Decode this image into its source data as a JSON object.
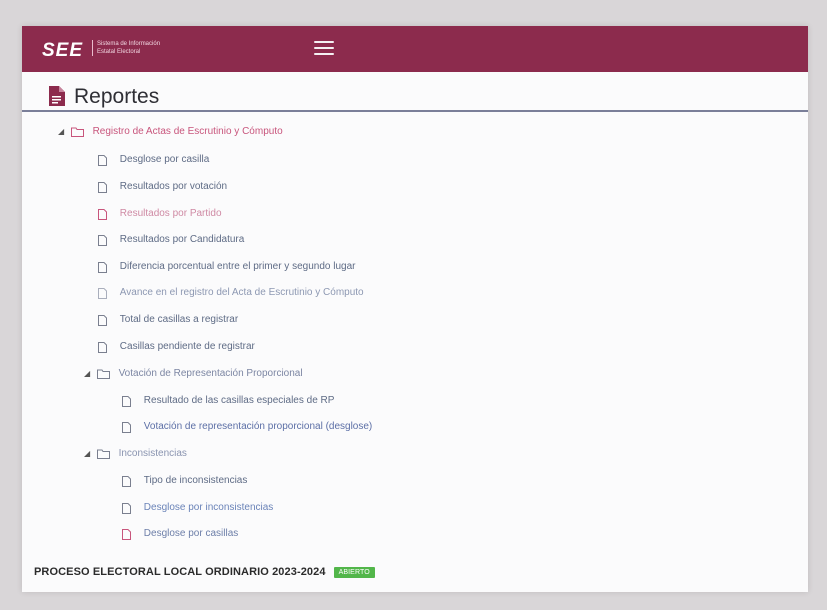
{
  "header": {
    "logo": "SEE",
    "logo_subtitle": "Sistema de Información Estatal Electoral",
    "bar_color": "#8c2b4d"
  },
  "page": {
    "title": "Reportes",
    "icon": "document-icon"
  },
  "tree": {
    "root": {
      "label": "Registro de Actas de Escrutinio y Cómputo",
      "color": "#c8557c"
    },
    "root_items": [
      {
        "label": "Desglose por casilla",
        "color": "#5e6b85"
      },
      {
        "label": "Resultados por votación",
        "color": "#5e6b85"
      },
      {
        "label": "Resultados por Partido",
        "color": "#cf8aa4"
      },
      {
        "label": "Resultados por Candidatura",
        "color": "#5e6b85"
      },
      {
        "label": "Diferencia porcentual entre el primer y segundo lugar",
        "color": "#5e6b85"
      },
      {
        "label": "Avance en el registro del Acta de Escrutinio y Cómputo",
        "color": "#8d98b2"
      },
      {
        "label": "Total de casillas a registrar",
        "color": "#5e6b85"
      },
      {
        "label": "Casillas pendiente de registrar",
        "color": "#5e6b85"
      }
    ],
    "rp": {
      "label": "Votación de Representación Proporcional",
      "color": "#7c86a3"
    },
    "rp_items": [
      {
        "label": "Resultado de las casillas especiales de RP",
        "color": "#5e6b85"
      },
      {
        "label": "Votación de representación proporcional (desglose)",
        "color": "#5c6fa6"
      }
    ],
    "inc": {
      "label": "Inconsistencias",
      "color": "#8a94b0"
    },
    "inc_items": [
      {
        "label": "Tipo de inconsistencias",
        "color": "#5e6b85"
      },
      {
        "label": "Desglose por inconsistencias",
        "color": "#6a83b8"
      },
      {
        "label": "Desglose por casillas",
        "color": "#6c7ea8"
      }
    ]
  },
  "footer": {
    "process": "PROCESO ELECTORAL LOCAL ORDINARIO 2023-2024",
    "status": "ABIERTO",
    "status_color": "#52b64a"
  }
}
